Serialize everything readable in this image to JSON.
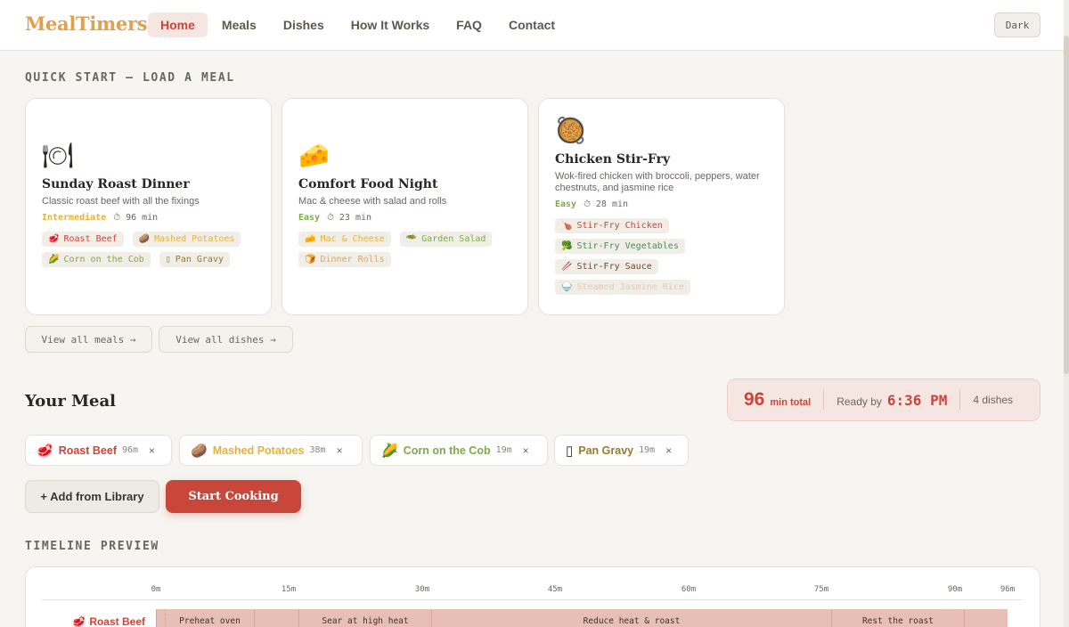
{
  "colors": {
    "accent": "#c8463a",
    "logo": "#e3a04a",
    "easy": "#7aab4d",
    "intermediate": "#e3b23c"
  },
  "header": {
    "logo": "MealTimers",
    "nav": [
      "Home",
      "Meals",
      "Dishes",
      "How It Works",
      "FAQ",
      "Contact"
    ],
    "active_nav": "Home",
    "theme_toggle": "Dark"
  },
  "quick_start": {
    "label": "QUICK START — LOAD A MEAL",
    "cards": [
      {
        "icon": "🍽",
        "title": "Sunday Roast Dinner",
        "desc": "Classic roast beef with all the fixings",
        "difficulty": "Intermediate",
        "time": "⏱ 96 min",
        "dishes": [
          {
            "icon": "🥩",
            "name": "Roast Beef",
            "color": "#c8463a"
          },
          {
            "icon": "🥔",
            "name": "Mashed Potatoes",
            "color": "#e3b23c"
          },
          {
            "icon": "🌽",
            "name": "Corn on the Cob",
            "color": "#7aab4d"
          },
          {
            "icon": "▯",
            "name": "Pan Gravy",
            "color": "#9a7a2c"
          }
        ]
      },
      {
        "icon": "🧀",
        "title": "Comfort Food Night",
        "desc": "Mac & cheese with salad and rolls",
        "difficulty": "Easy",
        "time": "⏱ 23 min",
        "dishes": [
          {
            "icon": "🧀",
            "name": "Mac & Cheese",
            "color": "#e3b23c"
          },
          {
            "icon": "🥗",
            "name": "Garden Salad",
            "color": "#7aab4d"
          },
          {
            "icon": "🍞",
            "name": "Dinner Rolls",
            "color": "#d9a86a"
          }
        ]
      },
      {
        "icon": "🥘",
        "title": "Chicken Stir-Fry",
        "desc": "Wok-fired chicken with broccoli, peppers, water chestnuts, and jasmine rice",
        "difficulty": "Easy",
        "time": "⏱ 28 min",
        "dishes": [
          {
            "icon": "🍗",
            "name": "Stir-Fry Chicken",
            "color": "#c8463a"
          },
          {
            "icon": "🥦",
            "name": "Stir-Fry Vegetables",
            "color": "#4d8a5a"
          },
          {
            "icon": "🥢",
            "name": "Stir-Fry Sauce",
            "color": "#6b4a2e"
          },
          {
            "icon": "🍚",
            "name": "Steamed Jasmine Rice",
            "color": "#e0c9b8"
          }
        ]
      }
    ],
    "view_meals": "View all meals →",
    "view_dishes": "View all dishes →"
  },
  "your_meal": {
    "title": "Your Meal",
    "total_num": "96",
    "total_unit": "min total",
    "ready_label": "Ready by",
    "ready_time": "6:36 PM",
    "dish_count": "4 dishes",
    "chips": [
      {
        "icon": "🥩",
        "name": "Roast Beef",
        "time": "96m",
        "color": "#c8463a"
      },
      {
        "icon": "🥔",
        "name": "Mashed Potatoes",
        "time": "38m",
        "color": "#e3b23c"
      },
      {
        "icon": "🌽",
        "name": "Corn on the Cob",
        "time": "19m",
        "color": "#7aab4d"
      },
      {
        "icon": "▯",
        "name": "Pan Gravy",
        "time": "19m",
        "color": "#9a7a2c"
      }
    ],
    "add_label": "+ Add from Library",
    "start_label": "Start Cooking",
    "remove_glyph": "×"
  },
  "timeline": {
    "label": "TIMELINE PREVIEW",
    "ticks": [
      "0m",
      "15m",
      "30m",
      "45m",
      "60m",
      "75m",
      "90m",
      "96m"
    ],
    "row": {
      "icon": "🥩",
      "name": "Roast Beef"
    },
    "segments": [
      "",
      "Preheat oven",
      "",
      "Sear at high heat",
      "Reduce heat & roast",
      "Rest the roast",
      ""
    ]
  }
}
